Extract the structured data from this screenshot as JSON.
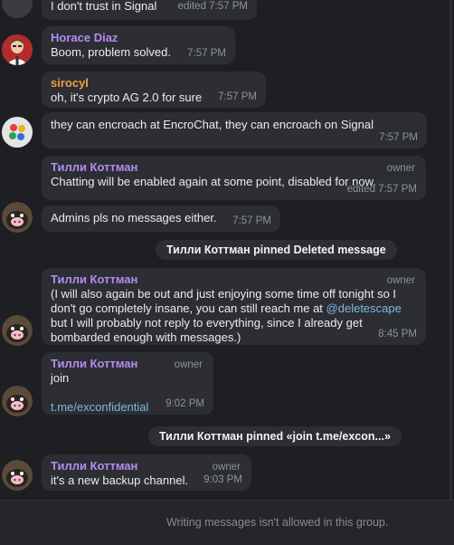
{
  "messages": [
    {
      "text": "I don't trust in Signal",
      "time": "edited 7:57 PM"
    },
    {
      "sender": "Horace Diaz",
      "sender_color": "#b48cf0",
      "text": "Boom, problem solved.",
      "time": "7:57 PM"
    },
    {
      "sender": "sirocyl",
      "sender_color": "#f0a040",
      "text": "oh, it's crypto AG 2.0 for sure",
      "time": "7:57 PM"
    },
    {
      "text": "they can encroach at EncroChat, they can encroach on Signal",
      "time": "7:57 PM"
    },
    {
      "sender": "Тилли Коттман",
      "sender_color": "#b48cf0",
      "role": "owner",
      "text": "Chatting will be enabled again at some point, disabled for now.",
      "time": "edited 7:57 PM"
    },
    {
      "text": "Admins pls no messages either.",
      "time": "7:57 PM"
    },
    {
      "sender": "Тилли Коттман",
      "role": "owner",
      "lines": [
        "(I will also again be out and just enjoying some time off tonight so I",
        "don't go completely insane, you can still reach me at ",
        "but I will probably not reply to everything, since I already get",
        "bombarded enough with messages.)"
      ],
      "link": "@deletescape",
      "time": "8:45 PM"
    },
    {
      "sender": "Тилли Коттман",
      "role": "owner",
      "text": "join",
      "link": "t.me/exconfidential",
      "time": "9:02 PM"
    },
    {
      "sender": "Тилли Коттман",
      "role": "owner",
      "text": "it's a new backup channel.",
      "time": "9:03 PM"
    }
  ],
  "service": [
    {
      "text": "Тилли Коттман pinned Deleted message"
    },
    {
      "text": "Тилли Коттман pinned «join  t.me/excon...»"
    }
  ],
  "footer": {
    "text": "Writing messages isn't allowed in this group."
  }
}
